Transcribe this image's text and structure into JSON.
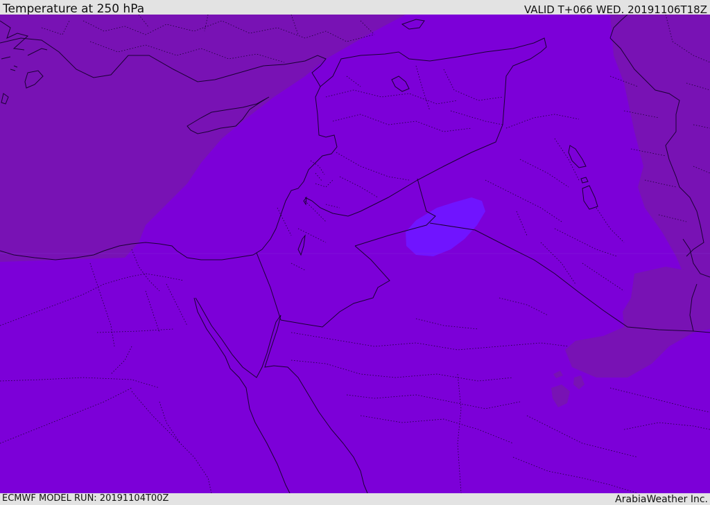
{
  "header": {
    "title": "Temperature at 250 hPa",
    "valid": "VALID T+066 WED. 20191106T18Z"
  },
  "footer": {
    "model_run": "ECMWF MODEL RUN: 20191104T00Z",
    "credit": "ArabiaWeather Inc."
  },
  "colors": {
    "warm_region": "#7812b4",
    "main_region": "#7c00d8",
    "cold_spot": "#7014ff",
    "outlines": "#1a0033"
  }
}
